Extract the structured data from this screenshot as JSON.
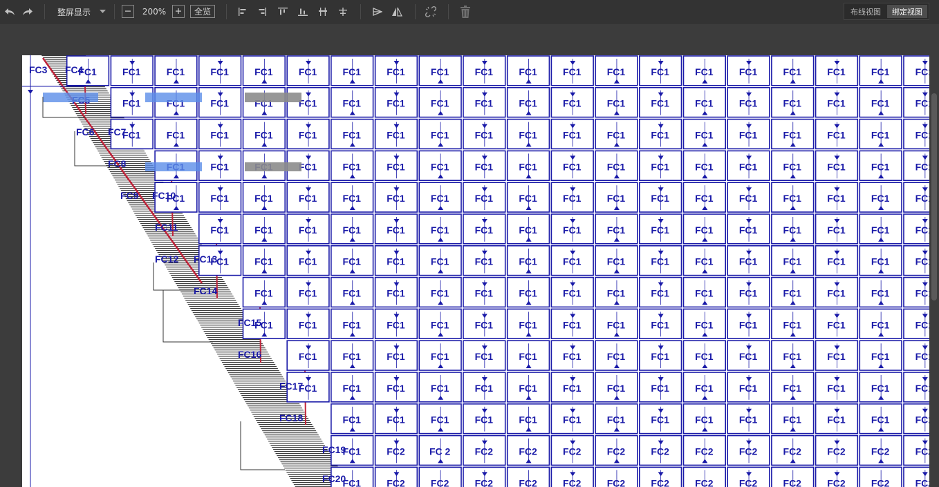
{
  "toolbar": {
    "undo_icon": "undo-icon",
    "redo_icon": "redo-icon",
    "display_mode_label": "整屏显示",
    "zoom_value": "200%",
    "fit_all_label": "全览",
    "view_wiring_label": "布线视图",
    "view_binding_label": "绑定视图"
  },
  "colors": {
    "grid_blue": "#1a1aa8",
    "red_line": "#c0243a",
    "highlight_blue": "#5b8de8",
    "highlight_gray": "#8c8c8c"
  },
  "diagonal_labels": [
    "FC3",
    "FC4",
    "FC5",
    "FC6",
    "FC7",
    "FC8",
    "FC9",
    "FC10",
    "FC11",
    "FC12",
    "FC13",
    "FC14",
    "FC15",
    "FC16",
    "FC17",
    "FC18",
    "FC19",
    "FC20"
  ],
  "grid": {
    "row1_label": "FC1",
    "body_label": "FC1",
    "bottom_label": "FC2",
    "bottom_alt_label": "FC 2"
  }
}
